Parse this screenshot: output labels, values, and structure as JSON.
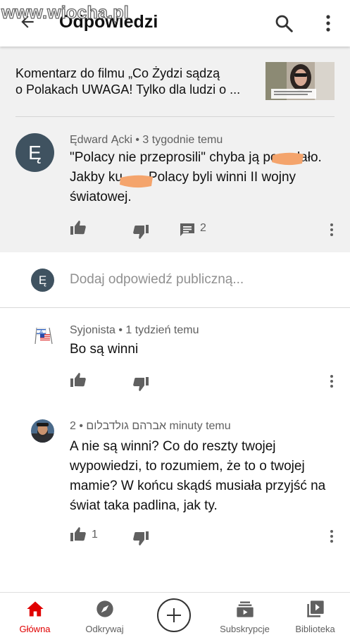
{
  "watermark": "www.wiocha.pl",
  "header": {
    "title": "Odpowiedzi"
  },
  "video": {
    "title_line1": "Komentarz do filmu „Co Żydzi sądzą",
    "title_line2": "o Polakach UWAGA! Tylko dla ludzi o ..."
  },
  "main_comment": {
    "avatar_letter": "Ę",
    "author": "Ędward Ącki",
    "time": "3 tygodnie temu",
    "line1": "\"Polacy nie przeprosili\" chyba ją po    dało.",
    "line2": "Jakby ku       Polacy byli winni II wojny",
    "line3": "światowej.",
    "reply_count": "2"
  },
  "reply_box": {
    "avatar_letter": "Ę",
    "placeholder": "Dodaj odpowiedź publiczną..."
  },
  "replies": [
    {
      "author": "Syjonista",
      "time": "1 tydzień temu",
      "lines": [
        "Bo są winni"
      ],
      "likes": ""
    },
    {
      "author": "אברהם גולדבלום",
      "time": "2 minuty temu",
      "lines": [
        "A nie są winni? Co do reszty twojej",
        "wypowiedzi, to rozumiem, że to o twojej",
        "mamie? W końcu skądś musiała przyjść na",
        "świat taka padlina, jak ty."
      ],
      "likes": "1"
    }
  ],
  "nav": [
    {
      "label": "Główna",
      "icon": "home-icon",
      "active": true
    },
    {
      "label": "Odkrywaj",
      "icon": "compass-icon"
    },
    {
      "label": "",
      "icon": "create-icon"
    },
    {
      "label": "Subskrypcje",
      "icon": "subscriptions-icon"
    },
    {
      "label": "Biblioteka",
      "icon": "library-icon"
    }
  ],
  "colors": {
    "accent": "#e00000",
    "avatar": "#3f5260",
    "header_bg": "#f1f1f1",
    "redaction": "#f4a46c"
  }
}
